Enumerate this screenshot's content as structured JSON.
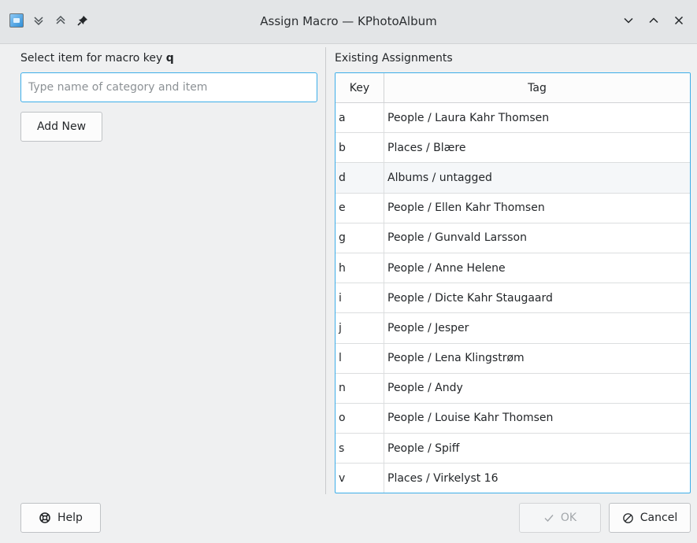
{
  "window": {
    "title": "Assign Macro — KPhotoAlbum"
  },
  "left": {
    "label_prefix": "Select item for macro key ",
    "macro_key": "q",
    "search_placeholder": "Type name of category and item",
    "search_value": "",
    "add_new_label": "Add New"
  },
  "right": {
    "label": "Existing Assignments",
    "columns": {
      "key": "Key",
      "tag": "Tag"
    },
    "rows": [
      {
        "key": "a",
        "tag": "People / Laura Kahr Thomsen"
      },
      {
        "key": "b",
        "tag": "Places / Blære"
      },
      {
        "key": "d",
        "tag": "Albums / untagged"
      },
      {
        "key": "e",
        "tag": "People / Ellen Kahr Thomsen"
      },
      {
        "key": "g",
        "tag": "People / Gunvald Larsson"
      },
      {
        "key": "h",
        "tag": "People / Anne Helene"
      },
      {
        "key": "i",
        "tag": "People / Dicte Kahr Staugaard"
      },
      {
        "key": "j",
        "tag": "People / Jesper"
      },
      {
        "key": "l",
        "tag": "People / Lena Klingstrøm"
      },
      {
        "key": "n",
        "tag": "People / Andy"
      },
      {
        "key": "o",
        "tag": "People / Louise Kahr Thomsen"
      },
      {
        "key": "s",
        "tag": "People / Spiff"
      },
      {
        "key": "v",
        "tag": "Places / Virkelyst 16"
      }
    ],
    "highlighted_row": 2
  },
  "footer": {
    "help_label": "Help",
    "ok_label": "OK",
    "cancel_label": "Cancel"
  },
  "icons": {
    "app": "kphotoalbum-app-icon",
    "keep_below": "chevrons-down-icon",
    "keep_above": "chevrons-up-icon",
    "pin": "pin-icon",
    "minimize": "chevron-down-icon",
    "maximize": "chevron-up-icon",
    "close": "close-icon",
    "help": "lifebuoy-icon",
    "ok": "checkmark-icon",
    "cancel": "cancel-circle-icon"
  },
  "colors": {
    "accent": "#3daee9",
    "window_bg": "#eff0f1",
    "titlebar_bg": "#e3e5e7"
  }
}
